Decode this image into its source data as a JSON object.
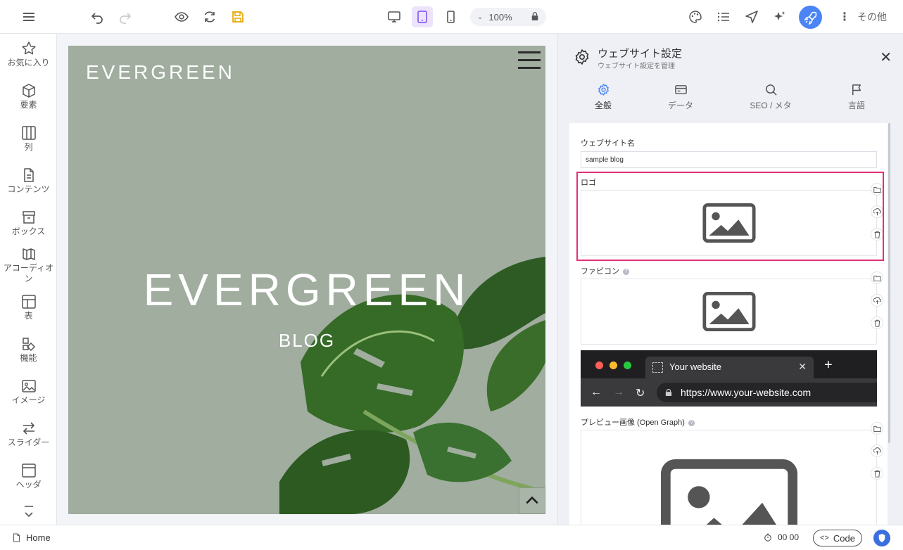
{
  "toolbar": {
    "zoom_value": "100%",
    "more_label": "その他"
  },
  "sidebar": {
    "items": [
      {
        "label": "お気に入り",
        "icon": "star-icon"
      },
      {
        "label": "要素",
        "icon": "cube-icon"
      },
      {
        "label": "列",
        "icon": "columns-icon"
      },
      {
        "label": "コンテンツ",
        "icon": "document-icon"
      },
      {
        "label": "ボックス",
        "icon": "archive-box-icon"
      },
      {
        "label": "アコーディオン",
        "icon": "accordion-icon"
      },
      {
        "label": "表",
        "icon": "table-icon"
      },
      {
        "label": "機能",
        "icon": "features-icon"
      },
      {
        "label": "イメージ",
        "icon": "image-icon"
      },
      {
        "label": "スライダー",
        "icon": "slider-arrows-icon"
      },
      {
        "label": "ヘッダ",
        "icon": "header-icon"
      }
    ]
  },
  "canvas": {
    "brand_small": "EVERGREEN",
    "brand_big": "EVERGREEN",
    "tagline": "BLOG"
  },
  "panel": {
    "title": "ウェブサイト設定",
    "subtitle": "ウェブサイト設定を管理",
    "tabs": [
      {
        "label": "全般",
        "icon": "gear-icon",
        "active": true
      },
      {
        "label": "データ",
        "icon": "card-icon",
        "active": false
      },
      {
        "label": "SEO / メタ",
        "icon": "search-icon",
        "active": false
      },
      {
        "label": "言語",
        "icon": "flag-icon",
        "active": false
      }
    ],
    "site_name_label": "ウェブサイト名",
    "site_name_value": "sample blog",
    "logo_label": "ロゴ",
    "favicon_label": "ファビコン",
    "browser": {
      "tab_title": "Your website",
      "url": "https://www.your-website.com"
    },
    "og_label": "プレビュー画像 (Open Graph)"
  },
  "statusbar": {
    "page": "Home",
    "timer": "00 00",
    "code_label": "Code"
  },
  "colors": {
    "accent_purple": "#8a5cf6",
    "publish_blue": "#4a84f5",
    "highlight_pink": "#e2317a",
    "canvas_bg": "#a0ad9f",
    "save_yellow": "#e8a600"
  }
}
